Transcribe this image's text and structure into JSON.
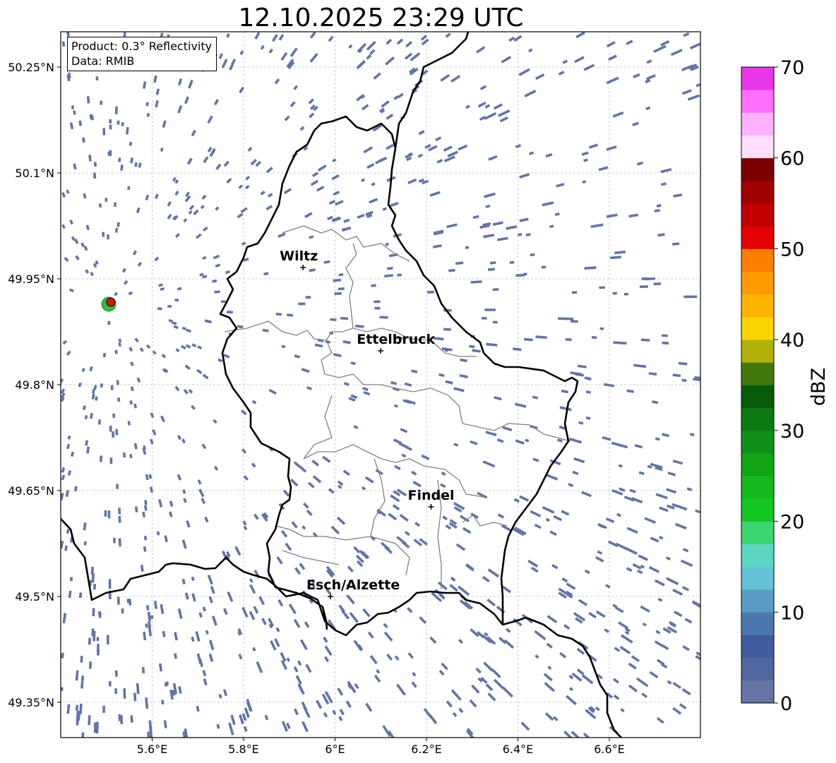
{
  "title": "12.10.2025 23:29 UTC",
  "info": {
    "product": "Product: 0.3° Reflectivity",
    "data_source": "Data: RMIB"
  },
  "lat_labels": [
    "50.25°N",
    "50.1°N",
    "49.95°N",
    "49.8°N",
    "49.65°N",
    "49.5°N",
    "49.35°N"
  ],
  "lon_labels": [
    "5.6°E",
    "5.8°E",
    "6°E",
    "6.2°E",
    "6.4°E",
    "6.6°E"
  ],
  "cities": [
    {
      "name": "Wiltz",
      "lon": 5.93,
      "lat": 49.966
    },
    {
      "name": "Ettelbruck",
      "lon": 6.1,
      "lat": 49.848
    },
    {
      "name": "Findel",
      "lon": 6.21,
      "lat": 49.627
    },
    {
      "name": "Esch/Alzette",
      "lon": 5.99,
      "lat": 49.5
    }
  ],
  "colorbar": {
    "label": "dBZ",
    "ticks": [
      "0",
      "10",
      "20",
      "30",
      "40",
      "50",
      "60",
      "70"
    ],
    "colors": [
      "#6374a5",
      "#52669f",
      "#425a9e",
      "#4a78ae",
      "#5a9bc4",
      "#63c1d8",
      "#5cd6c3",
      "#3bd66f",
      "#14c622",
      "#12b81d",
      "#11a516",
      "#109016",
      "#0c7a13",
      "#075b0b",
      "#44770b",
      "#b0b10a",
      "#fbd500",
      "#fcb400",
      "#ff9a00",
      "#ff7e00",
      "#e30000",
      "#c20000",
      "#a00000",
      "#7c0000",
      "#ffdeff",
      "#ffb1ff",
      "#ff6eff",
      "#e837e9"
    ]
  },
  "radar_site": {
    "lon": 5.505,
    "lat": 49.914
  }
}
